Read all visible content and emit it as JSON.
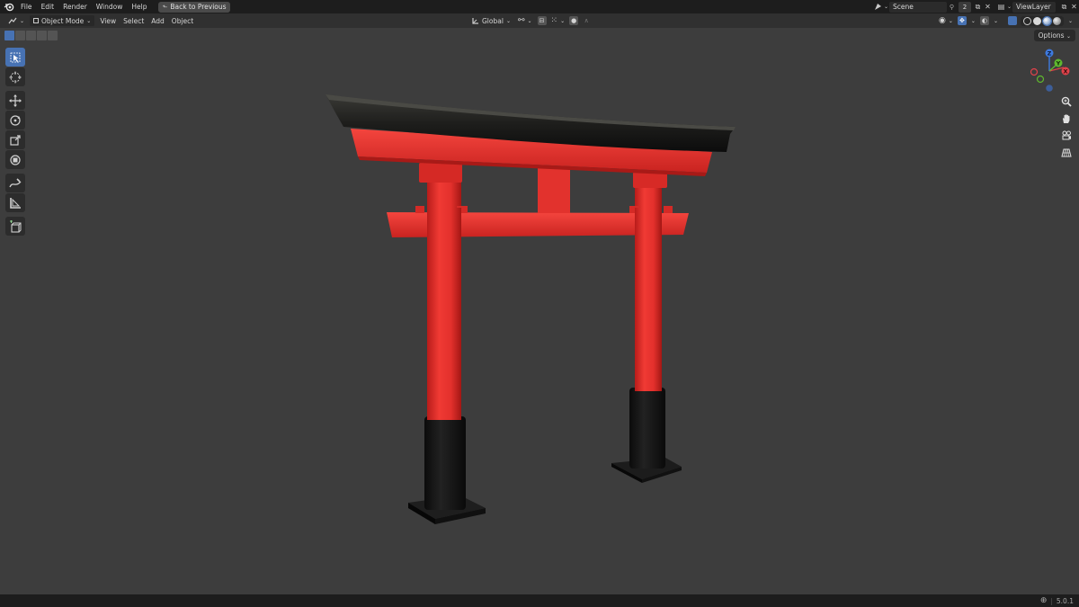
{
  "menu": {
    "file": "File",
    "edit": "Edit",
    "render": "Render",
    "window": "Window",
    "help": "Help",
    "back_to_previous": "Back to Previous"
  },
  "topbar_right": {
    "scene_name": "Scene",
    "scene_number": "2",
    "view_layer": "ViewLayer"
  },
  "header": {
    "mode": "Object Mode",
    "view": "View",
    "select": "Select",
    "add": "Add",
    "object": "Object",
    "transform_orientation": "Global"
  },
  "options_label": "Options",
  "gizmo": {
    "z_label": "Z",
    "y_label": "Y",
    "x_label": "X"
  },
  "statusbar": {
    "version": "5.0.1"
  },
  "colors": {
    "accent": "#4772b3",
    "torii_red": "#e8302c",
    "torii_black": "#151515",
    "background": "#3d3d3d"
  },
  "icons": {
    "blender": "blender-logo-icon",
    "select": "select-box-icon",
    "cursor": "cursor-icon",
    "move": "move-icon",
    "rotate": "rotate-icon",
    "scale": "scale-icon",
    "transform": "transform-icon",
    "annotate": "annotate-icon",
    "measure": "measure-icon",
    "add_cube": "add-cube-icon"
  }
}
